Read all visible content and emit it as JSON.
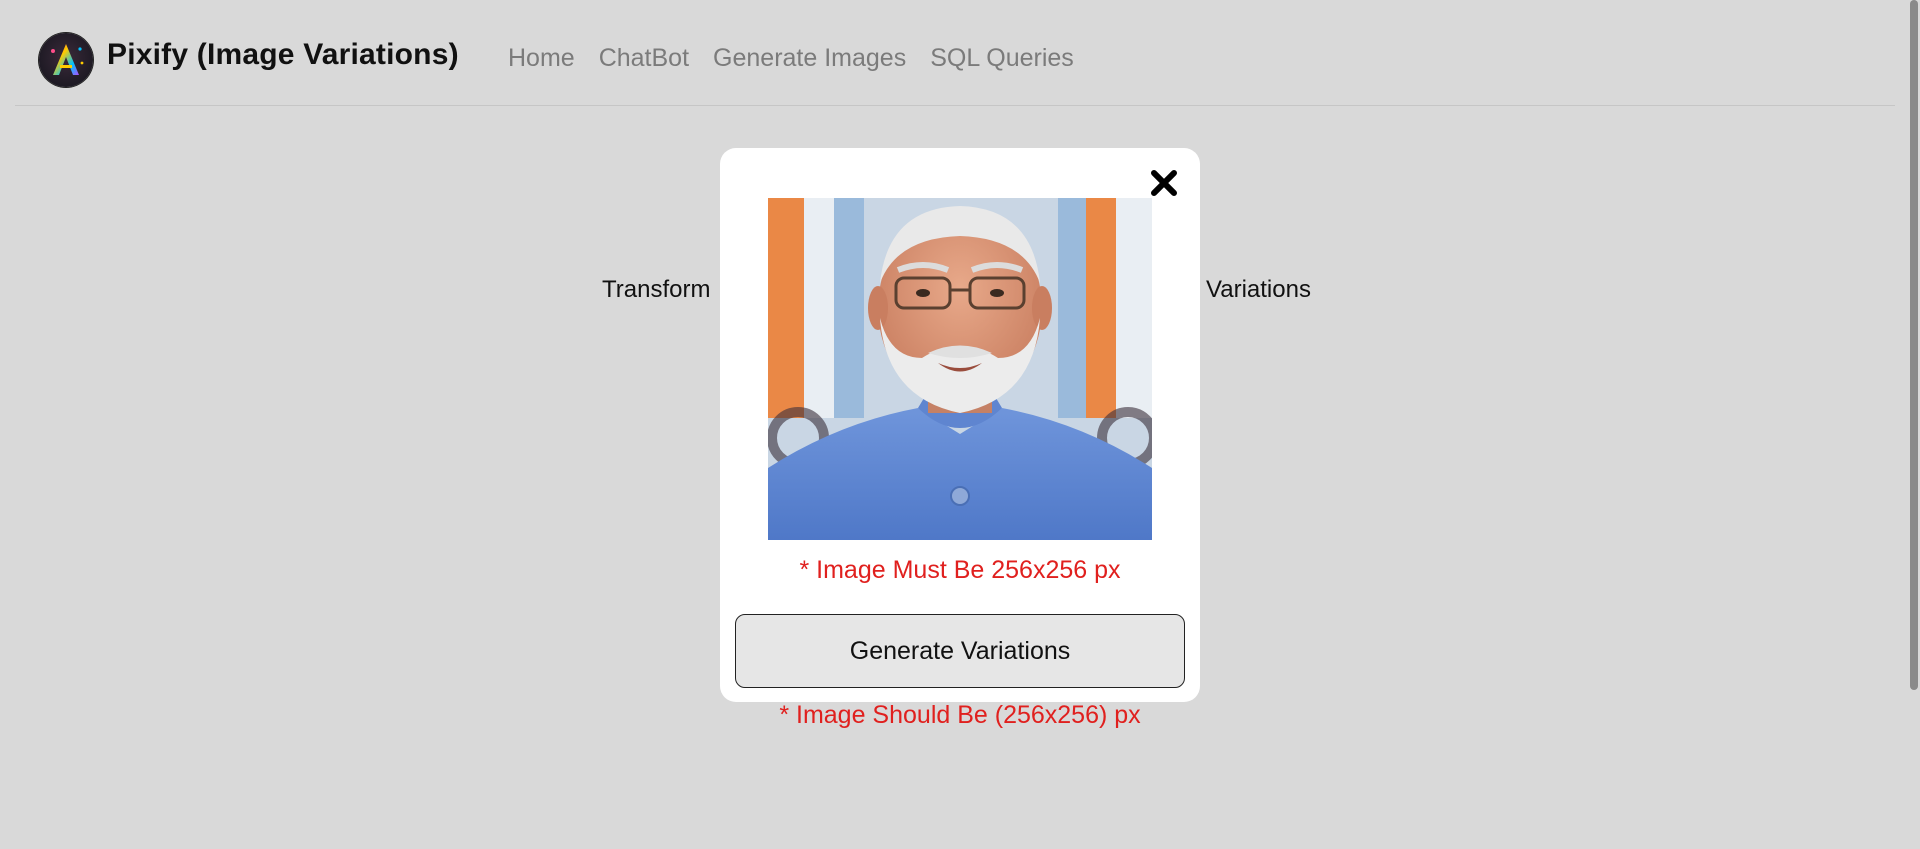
{
  "app": {
    "logo_icon": "pixify-logo-icon",
    "brand": "Pixify (Image Variations)"
  },
  "nav": {
    "items": [
      {
        "label": "Home"
      },
      {
        "label": "ChatBot"
      },
      {
        "label": "Generate Images"
      },
      {
        "label": "SQL Queries"
      }
    ]
  },
  "background": {
    "text_left": "Transform",
    "text_right": "Variations",
    "warning": "* Image Should Be (256x256) px"
  },
  "modal": {
    "close_icon": "close-icon",
    "image_alt": "uploaded-portrait-photo",
    "warning": "* Image Must Be 256x256 px",
    "button_label": "Generate Variations"
  },
  "colors": {
    "page_bg": "#d9d9d9",
    "warning_red": "#e0201e",
    "nav_link": "#7b7b7b",
    "modal_bg": "#ffffff",
    "button_bg": "#e6e6e6"
  }
}
